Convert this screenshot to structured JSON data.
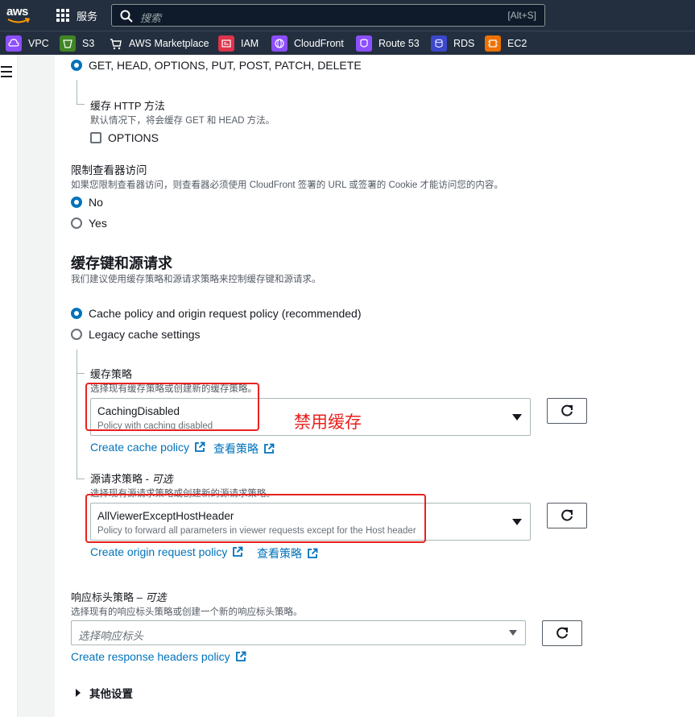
{
  "topnav": {
    "logo": "aws",
    "services_label": "服务",
    "search_placeholder": "搜索",
    "search_shortcut": "[Alt+S]"
  },
  "favorites": [
    {
      "label": "VPC",
      "icon": "vpc-icon",
      "color": "#8c4fff"
    },
    {
      "label": "S3",
      "icon": "s3-icon",
      "color": "#3f8624"
    },
    {
      "label": "AWS Marketplace",
      "icon": "cart-icon",
      "color": "#232f3e"
    },
    {
      "label": "IAM",
      "icon": "iam-icon",
      "color": "#dd344c"
    },
    {
      "label": "CloudFront",
      "icon": "cloudfront-icon",
      "color": "#8c4fff"
    },
    {
      "label": "Route 53",
      "icon": "route53-icon",
      "color": "#8c4fff"
    },
    {
      "label": "RDS",
      "icon": "rds-icon",
      "color": "#3b48cc"
    },
    {
      "label": "EC2",
      "icon": "ec2-icon",
      "color": "#ed7100"
    }
  ],
  "form": {
    "methods_option": "GET, HEAD, OPTIONS, PUT, POST, PATCH, DELETE",
    "cache_http_title": "缓存 HTTP 方法",
    "cache_http_desc": "默认情况下，将会缓存 GET 和 HEAD 方法。",
    "options_label": "OPTIONS",
    "restrict_title": "限制查看器访问",
    "restrict_desc": "如果您限制查看器访问，则查看器必须使用 CloudFront 签署的 URL 或签署的 Cookie 才能访问您的内容。",
    "restrict_no": "No",
    "restrict_yes": "Yes",
    "cachekey_title": "缓存键和源请求",
    "cachekey_desc": "我们建议使用缓存策略和源请求策略来控制缓存键和源请求。",
    "opt_recommended": "Cache policy and origin request policy (recommended)",
    "opt_legacy": "Legacy cache settings",
    "cache_policy_title": "缓存策略",
    "cache_policy_desc": "选择现有缓存策略或创建新的缓存策略。",
    "cache_policy_value": "CachingDisabled",
    "cache_policy_sub": "Policy with caching disabled",
    "create_cache_policy": "Create cache policy",
    "view_policy": "查看策略",
    "origin_policy_title": "源请求策略 - ",
    "optional": "可选",
    "origin_policy_desc": "选择现有源请求策略或创建新的源请求策略。",
    "origin_policy_value": "AllViewerExceptHostHeader",
    "origin_policy_sub": "Policy to forward all parameters in viewer requests except for the Host header",
    "create_origin_policy": "Create origin request policy",
    "view_policy_2": "查看策略",
    "response_title": "响应标头策略 – ",
    "response_desc": "选择现有的响应标头策略或创建一个新的响应标头策略。",
    "response_placeholder": "选择响应标头",
    "create_response_policy": "Create response headers policy",
    "more_settings": "其他设置"
  },
  "annotation": {
    "label": "禁用缓存",
    "color": "#e8211f"
  }
}
